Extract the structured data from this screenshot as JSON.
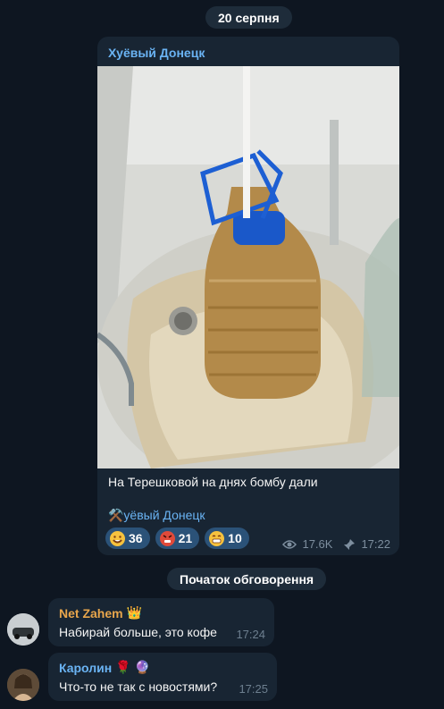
{
  "date_separator": "20 серпня",
  "post": {
    "channel_name": "Хуёвый Донецк",
    "caption": "На Терешковой на днях бомбу дали",
    "signature": "⚒️уёвый Донецк",
    "reactions": [
      {
        "emoji": "rofl-face",
        "count": "36"
      },
      {
        "emoji": "angry-face",
        "count": "21"
      },
      {
        "emoji": "grin-face",
        "count": "10"
      }
    ],
    "views": "17.6K",
    "time": "17:22"
  },
  "thread_label": "Початок обговорення",
  "comments": [
    {
      "author": "Net Zahem",
      "badge": "👑",
      "text": "Набирай больше, это кофе",
      "time": "17:24",
      "author_color": "#e8a64c"
    },
    {
      "author": "Каролин",
      "badge": "🌹 🔮",
      "text": "Что-то не так с новостями?",
      "time": "17:25",
      "author_color": "#6ab3f3"
    }
  ],
  "colors": {
    "background": "#0e1621",
    "bubble": "#182533",
    "accent": "#6ab3f3",
    "reaction_bg": "#2b5278"
  }
}
